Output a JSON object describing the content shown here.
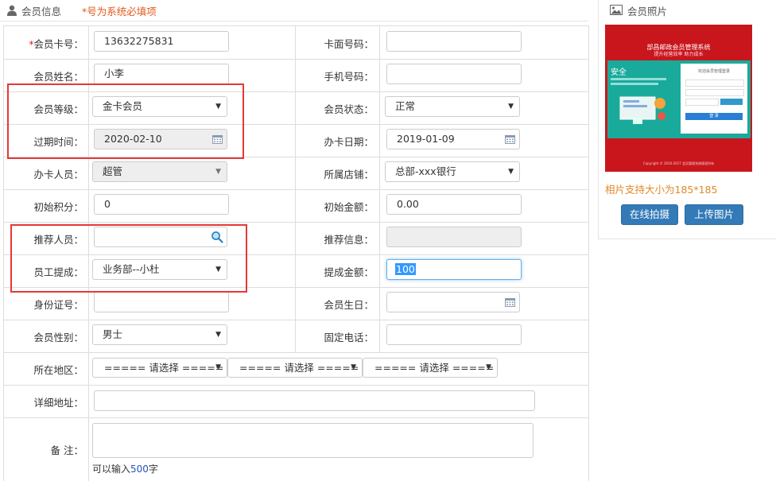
{
  "header": {
    "title": "会员信息",
    "required_note": "*号为系统必填项"
  },
  "form": {
    "card_no": {
      "star": "*",
      "label": "会员卡号：",
      "value": "13632275831"
    },
    "face_no": {
      "label": "卡面号码：",
      "value": ""
    },
    "name": {
      "label": "会员姓名：",
      "value": "小李"
    },
    "mobile": {
      "label": "手机号码：",
      "value": ""
    },
    "level": {
      "label": "会员等级：",
      "value": "金卡会员"
    },
    "status": {
      "label": "会员状态：",
      "value": "正常"
    },
    "expire": {
      "label": "过期时间：",
      "value": "2020-02-10"
    },
    "open_date": {
      "label": "办卡日期：",
      "value": "2019-01-09"
    },
    "operator": {
      "label": "办卡人员：",
      "value": "超管"
    },
    "store": {
      "label": "所属店铺：",
      "value": "总部-xxx银行"
    },
    "points": {
      "label": "初始积分：",
      "value": "0"
    },
    "amount": {
      "label": "初始金额：",
      "value": "0.00"
    },
    "referrer": {
      "label": "推荐人员：",
      "value": ""
    },
    "ref_info": {
      "label": "推荐信息：",
      "value": ""
    },
    "commission": {
      "label": "员工提成：",
      "value": "业务部--小杜"
    },
    "commission_amt": {
      "label": "提成金额：",
      "value": "100"
    },
    "idcard": {
      "label": "身份证号：",
      "value": ""
    },
    "birthday": {
      "label": "会员生日：",
      "value": ""
    },
    "gender": {
      "label": "会员性别：",
      "value": "男士"
    },
    "phone": {
      "label": "固定电话：",
      "value": ""
    },
    "region": {
      "label": "所在地区：",
      "placeholder": "===== 请选择 ====="
    },
    "address": {
      "label": "详细地址：",
      "value": ""
    },
    "remark": {
      "label": "备 注：",
      "hint_prefix": "可以输入",
      "hint_count": "500",
      "hint_suffix": "字"
    }
  },
  "photo": {
    "title": "会员照片",
    "thumb_title": "部昌邮政会员管理系统",
    "thumb_subtitle": "提升经营效率 助力成长",
    "thumb_secure": "安全",
    "thumb_login_title": "欢迎会员管理登录",
    "thumb_login_btn": "登 录",
    "thumb_footer": "Copyright © 2010-2017 会员管理系统版权所有",
    "size_note": "相片支持大小为185*185",
    "btn_camera": "在线拍摄",
    "btn_upload": "上传图片"
  },
  "colors": {
    "accent": "#337ab7",
    "note": "#e25a1c",
    "highlight_box": "#e53935",
    "photo_bg": "#c8161c"
  }
}
